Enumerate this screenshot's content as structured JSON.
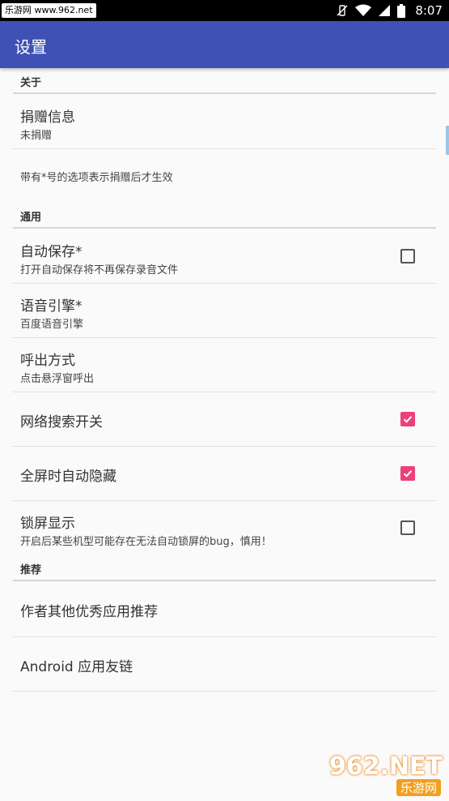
{
  "status_bar": {
    "watermark_text": "乐游网 www.962.net",
    "time": "8:07",
    "icons": [
      "vibrate-off-icon",
      "wifi-icon",
      "cell-signal-icon",
      "battery-icon"
    ]
  },
  "app_bar": {
    "title": "设置"
  },
  "sections": {
    "about": {
      "label": "关于",
      "donate": {
        "title": "捐赠信息",
        "summary": "未捐赠"
      },
      "note": "带有*号的选项表示捐赠后才生效"
    },
    "general": {
      "label": "通用",
      "auto_save": {
        "title": "自动保存*",
        "summary": "打开自动保存将不再保存录音文件",
        "checked": false
      },
      "tts_engine": {
        "title": "语音引擎*",
        "summary": "百度语音引擎"
      },
      "invoke_mode": {
        "title": "呼出方式",
        "summary": "点击悬浮窗呼出"
      },
      "web_search": {
        "title": "网络搜索开关",
        "checked": true
      },
      "fullscreen_hide": {
        "title": "全屏时自动隐藏",
        "checked": true
      },
      "lockscreen_show": {
        "title": "锁屏显示",
        "summary": "开启后某些机型可能存在无法自动锁屏的bug，慎用！",
        "checked": false
      }
    },
    "recommend": {
      "label": "推荐",
      "author_apps": {
        "title": "作者其他优秀应用推荐"
      },
      "android_links": {
        "title": "Android 应用友链"
      }
    }
  },
  "colors": {
    "appbar": "#3f51b5",
    "accent": "#ec407a",
    "background": "#fafafa"
  },
  "watermark_logo": {
    "number": "962.NET",
    "text": "乐游网"
  }
}
